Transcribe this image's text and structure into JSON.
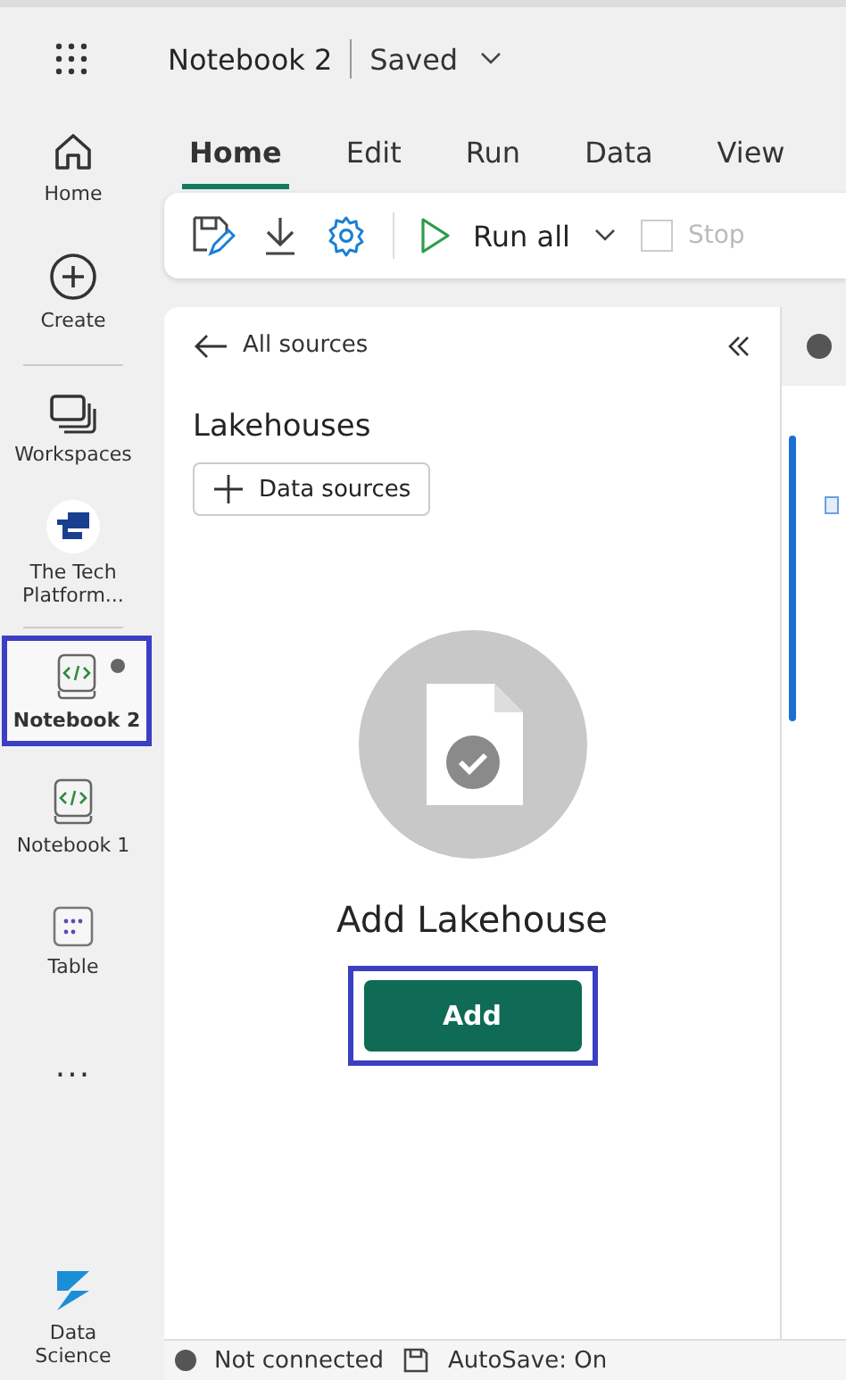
{
  "header": {
    "title": "Notebook 2",
    "status": "Saved"
  },
  "sidebar": {
    "items": [
      {
        "kind": "home",
        "label": "Home",
        "selected": false
      },
      {
        "kind": "create",
        "label": "Create",
        "selected": false
      },
      {
        "kind": "workspaces",
        "label": "Workspaces",
        "selected": false
      },
      {
        "kind": "workspace",
        "label": "The Tech Platform...",
        "selected": false
      },
      {
        "kind": "notebook",
        "label": "Notebook 2",
        "selected": true,
        "unsaved": true,
        "highlighted": true
      },
      {
        "kind": "notebook",
        "label": "Notebook 1",
        "selected": false
      },
      {
        "kind": "table",
        "label": "Table",
        "selected": false
      },
      {
        "kind": "more",
        "label": "...",
        "selected": false
      }
    ],
    "footer": {
      "label": "Data Science"
    }
  },
  "tabs": [
    {
      "label": "Home",
      "selected": true
    },
    {
      "label": "Edit",
      "selected": false
    },
    {
      "label": "Run",
      "selected": false
    },
    {
      "label": "Data",
      "selected": false
    },
    {
      "label": "View",
      "selected": false
    }
  ],
  "toolbar": {
    "run_all": "Run all",
    "stop": "Stop"
  },
  "panel": {
    "back": "All sources",
    "heading": "Lakehouses",
    "add_source": "Data sources",
    "empty_title": "Add Lakehouse",
    "add_button": "Add",
    "add_highlighted": true
  },
  "status_bar": {
    "connection": "Not connected",
    "autosave": "AutoSave: On"
  }
}
